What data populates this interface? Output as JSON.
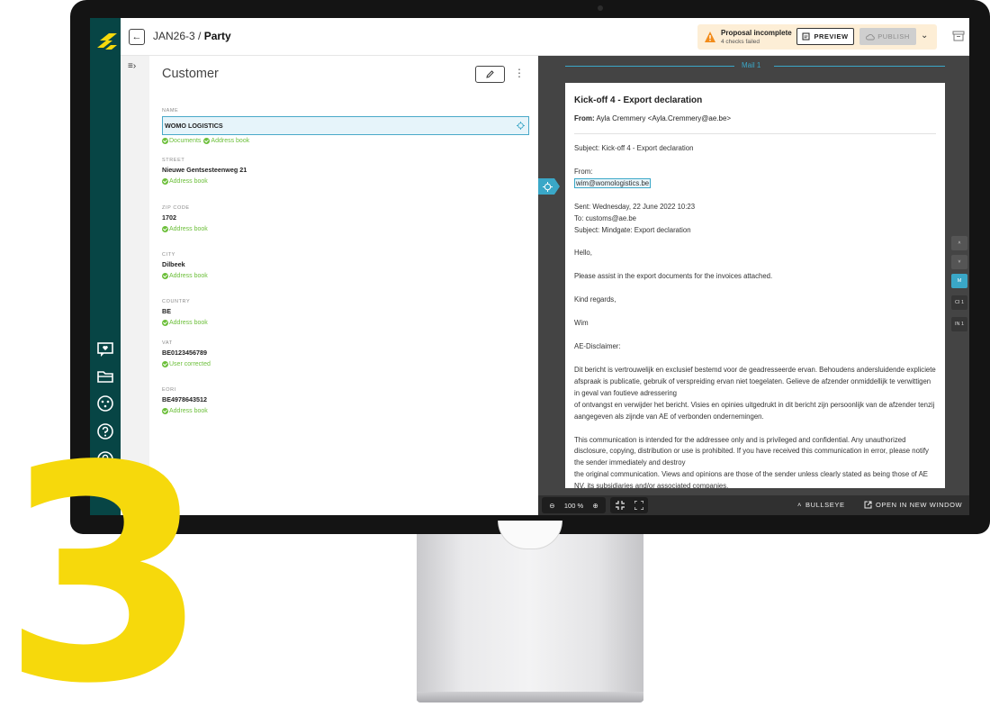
{
  "header": {
    "breadcrumb_id": "JAN26-3 /",
    "breadcrumb_page": "Party",
    "alert_title": "Proposal incomplete",
    "alert_sub": "4 checks failed",
    "preview_label": "PREVIEW",
    "publish_label": "PUBLISH"
  },
  "customer": {
    "title": "Customer",
    "fields": [
      {
        "label": "NAME",
        "value": "WOMO LOGISTICS",
        "sources": [
          "Documents",
          "Address book"
        ]
      },
      {
        "label": "STREET",
        "value": "Nieuwe Gentsesteenweg 21",
        "sources": [
          "Address book"
        ]
      },
      {
        "label": "ZIP CODE",
        "value": "1702",
        "sources": [
          "Address book"
        ]
      },
      {
        "label": "CITY",
        "value": "Dilbeek",
        "sources": [
          "Address book"
        ]
      },
      {
        "label": "COUNTRY",
        "value": "BE",
        "sources": [
          "Address book"
        ]
      },
      {
        "label": "VAT",
        "value": "BE0123456789",
        "sources": [
          "User corrected"
        ]
      },
      {
        "label": "EORI",
        "value": "BE4978643512",
        "sources": [
          "Address book"
        ]
      }
    ]
  },
  "viewer": {
    "tab_label": "Mail 1",
    "doc_title": "Kick-off 4 - Export declaration",
    "from_label": "From:",
    "from_value": "Ayla Cremmery <Ayla.Cremmery@ae.be>",
    "subject_line": "Subject: Kick-off 4 - Export declaration",
    "fwd_from_label": "From:",
    "fwd_from_email": "wim@womologistics.be",
    "sent_line": "Sent: Wednesday, 22 June 2022 10:23",
    "to_line": "To: customs@ae.be",
    "fwd_subject_line": "Subject: Mindgate: Export declaration",
    "greeting": "Hello,",
    "body_line": "Please assist in the export documents for the invoices attached.",
    "closing": "Kind regards,",
    "signature": "Wim",
    "disclaimer_head": "AE-Disclaimer:",
    "disclaimer_nl": "Dit bericht is vertrouwelijk en exclusief bestemd voor de geadresseerde ervan. Behoudens andersluidende expliciete afspraak is publicatie, gebruik of verspreiding ervan niet toegelaten. Gelieve de afzender onmiddellijk te verwittigen in geval van foutieve adressering",
    "disclaimer_nl_2": " of ontvangst en verwijder het bericht. Visies en opinies uitgedrukt in dit bericht zijn persoonlijk van de afzender tenzij aangegeven als zijnde van AE of verbonden ondernemingen.",
    "disclaimer_en": "This communication is intended for the addressee only and is privileged and confidential. Any unauthorized disclosure, copying, distribution or use is prohibited. If you have received this communication in error, please notify the sender immediately and destroy",
    "disclaimer_en_2": " the original communication. Views and opinions are those of the sender unless clearly stated as being those of AE NV, its subsidiaries and/or associated companies.",
    "nav_tabs": [
      "M",
      "CI 1",
      "IN 1"
    ],
    "zoom_value": "100 %",
    "bullseye_label": "BULLSEYE",
    "open_new_label": "OPEN IN NEW WINDOW"
  },
  "overlay": {
    "big_number": "3"
  },
  "colors": {
    "rail": "#074545",
    "accent": "#3aa7c7",
    "source_green": "#6cbf3a",
    "big_number": "#f6d90c",
    "alert_bg": "#fdeed6"
  }
}
